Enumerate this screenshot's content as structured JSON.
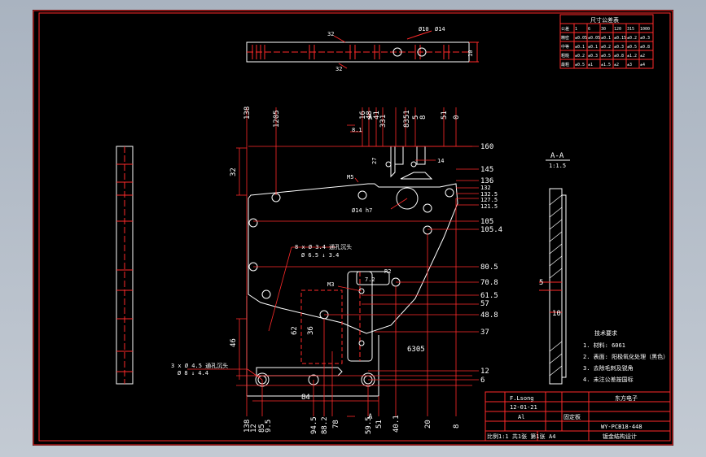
{
  "colors": {
    "frame": "#ff2a2a",
    "part": "#ffffff",
    "dimension": "#ff2a2a",
    "text": "#ffffff",
    "paper": "#000000"
  },
  "top_view": {
    "d1": "32",
    "d2": "Ø10",
    "d3": "Ø14",
    "d4": "10",
    "d5": "32"
  },
  "top_dims": [
    "138",
    "1205",
    "16",
    "48",
    "41",
    "331",
    "8351",
    "5",
    "8",
    "51",
    "0"
  ],
  "right_dims": [
    "160",
    "145",
    "136",
    "132",
    "132.5",
    "127.5",
    "121.5",
    "105",
    "105.4",
    "80.5",
    "70.8",
    "61.5",
    "57",
    "48.8",
    "37",
    "12",
    "6"
  ],
  "left_dims": [
    "32",
    "46"
  ],
  "bottom_dims": [
    "138",
    "12",
    "85",
    "9.5",
    "84",
    "94.5",
    "88.2",
    "78",
    "59.5",
    "51",
    "40.1",
    "20",
    "8"
  ],
  "callouts": {
    "m5": "M5",
    "phi14": "Ø14 h7",
    "holes_8": "8 x Ø 3.4 通孔沉头",
    "cbore": "Ø 6.5 ↓ 3.4",
    "r2": "R2",
    "m3": "M3",
    "d7_2": "7.2",
    "d62": "62",
    "d36": "36",
    "d27": "27",
    "d14": "14",
    "d8_1": "8.1",
    "d6305": "6305",
    "d84": "84",
    "holes_3": "3 x Ø 4.5 通孔沉头",
    "cbore2": "Ø 8 ↓ 4.4",
    "section_a": "A"
  },
  "section_view": {
    "title": "A-A",
    "scale": "1:1.5",
    "d5": "5",
    "d10": "10"
  },
  "notes": {
    "title": "技术要求",
    "items": [
      "1. 材料: 6061",
      "2. 表面: 阳极氧化处理（黑色）",
      "3. 去除毛刺及锐角",
      "4. 未注公差按国标"
    ]
  },
  "table": {
    "title": "尺寸公差表",
    "header": [
      "公差",
      "1",
      "6",
      "30",
      "120",
      "315",
      "1000"
    ],
    "rows": [
      [
        "精密",
        "±0.05",
        "±0.05",
        "±0.1",
        "±0.15",
        "±0.2",
        "±0.3"
      ],
      [
        "中等",
        "±0.1",
        "±0.1",
        "±0.2",
        "±0.3",
        "±0.5",
        "±0.8"
      ],
      [
        "粗糙",
        "±0.2",
        "±0.3",
        "±0.5",
        "±0.8",
        "±1.2",
        "±2"
      ],
      [
        "最粗",
        "±0.5",
        "±1",
        "±1.5",
        "±2",
        "±3",
        "±4"
      ]
    ]
  },
  "title_block": {
    "designer": "F.Lsong",
    "date": "12-01-21",
    "material": "Al",
    "name": "固定板",
    "drawing_no": "WY-PCB18-448",
    "company": "东方电子",
    "sheet_size": "A4",
    "footer_left": "比例1:1  共1张  第1张",
    "footer_right": "钣金结构设计"
  }
}
